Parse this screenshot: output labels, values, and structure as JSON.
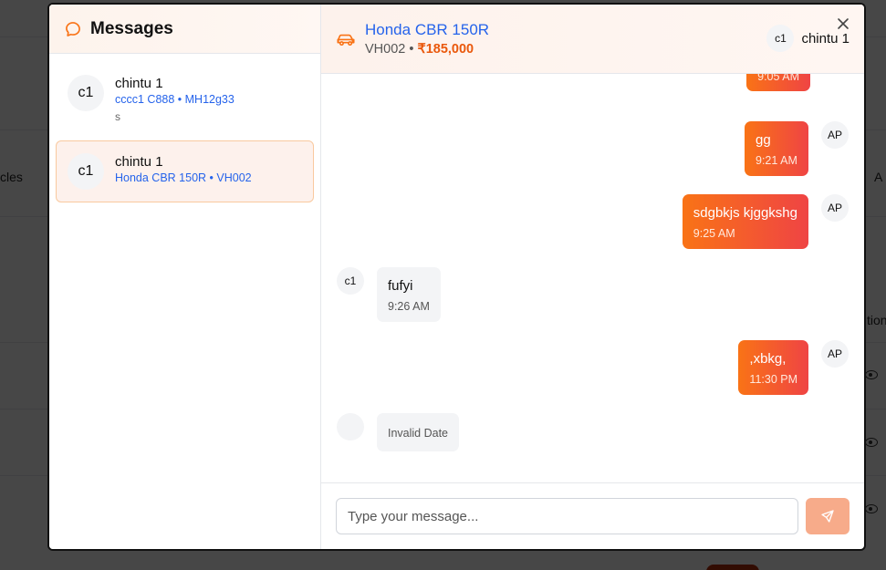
{
  "background": {
    "partial_texts": [
      "cles",
      "A",
      "tion"
    ]
  },
  "sidebar": {
    "title": "Messages",
    "icon": "chat-bubble-icon",
    "conversations": [
      {
        "avatar": "c1",
        "name": "chintu 1",
        "subtitle": "cccc1 C888 • MH12g33",
        "last_message": "s",
        "active": false
      },
      {
        "avatar": "c1",
        "name": "chintu 1",
        "subtitle": "Honda CBR 150R • VH002",
        "last_message": "",
        "active": true
      }
    ]
  },
  "chat_header": {
    "icon": "car-icon",
    "vehicle_title": "Honda CBR 150R",
    "vehicle_code": "VH002",
    "separator": "•",
    "price": "₹185,000",
    "user_avatar": "c1",
    "user_name": "chintu 1",
    "close_icon": "close-icon"
  },
  "messages": [
    {
      "direction": "out",
      "text": "",
      "time": "9:05 AM",
      "avatar": ""
    },
    {
      "direction": "out",
      "text": "gg",
      "time": "9:21 AM",
      "avatar": "AP"
    },
    {
      "direction": "out",
      "text": "sdgbkjs kjggkshg",
      "time": "9:25 AM",
      "avatar": "AP"
    },
    {
      "direction": "in",
      "text": "fufyi",
      "time": "9:26 AM",
      "avatar": "c1"
    },
    {
      "direction": "out",
      "text": ",xbkg,",
      "time": "11:30 PM",
      "avatar": "AP"
    },
    {
      "direction": "in",
      "text": "",
      "time": "Invalid Date",
      "avatar": ""
    }
  ],
  "composer": {
    "placeholder": "Type your message...",
    "send_icon": "send-icon"
  },
  "colors": {
    "accent": "#f97316",
    "accent_end": "#ef4444",
    "link": "#2563eb",
    "price": "#ea580c"
  }
}
